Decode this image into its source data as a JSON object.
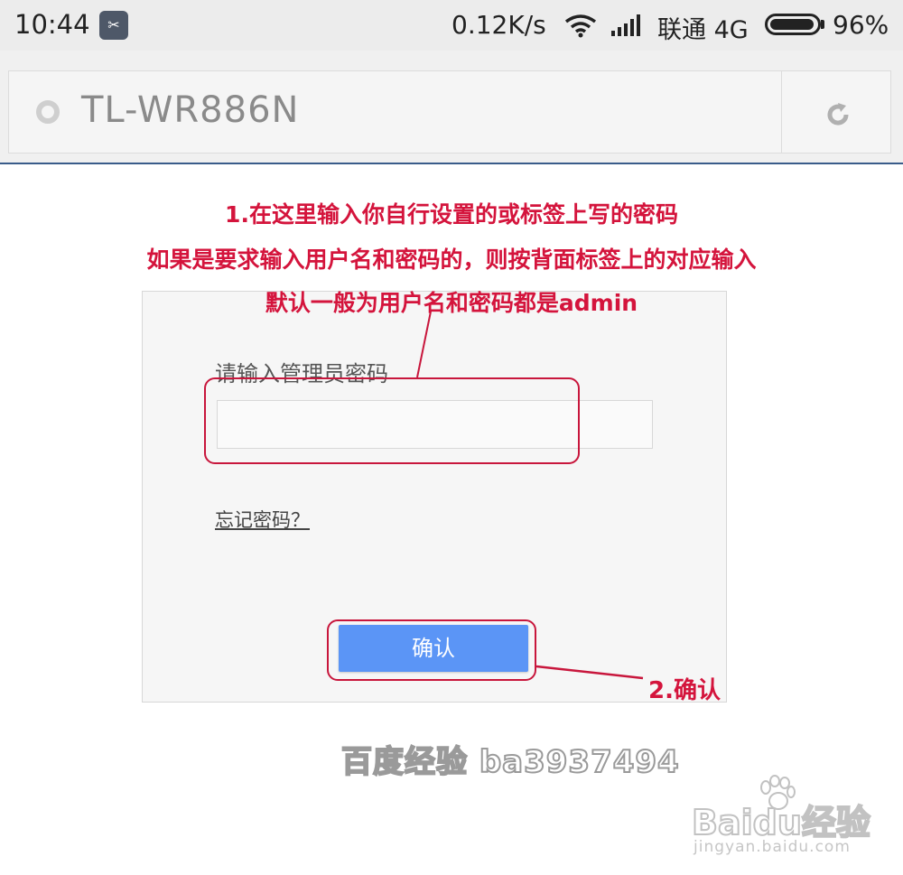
{
  "status_bar": {
    "time": "10:44",
    "net_speed": "0.12K/s",
    "carrier": "联通 4G",
    "battery_pct": "96%",
    "battery_level": 0.96
  },
  "address_bar": {
    "title": "TL-WR886N"
  },
  "annotations": {
    "line1": "1.在这里输入你自行设置的或标签上写的密码",
    "line2": "如果是要求输入用户名和密码的，则按背面标签上的对应输入",
    "line3": "默认一般为用户名和密码都是admin",
    "step2": "2.确认",
    "color": "#d4143c"
  },
  "login": {
    "password_label": "请输入管理员密码",
    "password_value": "",
    "forgot_link": "忘记密码？",
    "confirm_button": "确认",
    "button_color": "#5b95f6"
  },
  "watermarks": {
    "author": "百度经验 ba3937494",
    "logo": "Baidu经验",
    "url": "jingyan.baidu.com"
  }
}
